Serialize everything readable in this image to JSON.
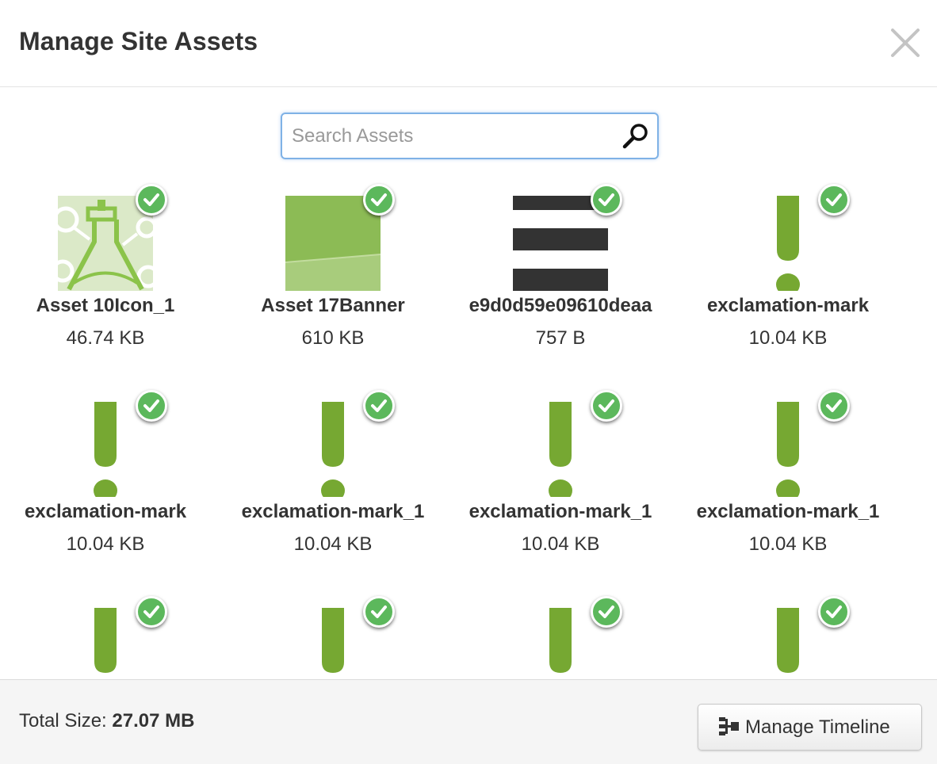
{
  "header": {
    "title": "Manage Site Assets",
    "close_icon": "close-icon"
  },
  "search": {
    "placeholder": "Search Assets",
    "value": "",
    "icon": "search-icon"
  },
  "assets": [
    {
      "name": "Asset 10Icon_1",
      "size": "46.74 KB",
      "thumb": "flask",
      "selected": true
    },
    {
      "name": "Asset 17Banner",
      "size": "610 KB",
      "thumb": "banner",
      "selected": true
    },
    {
      "name": "e9d0d59e09610deaa",
      "size": "757 B",
      "thumb": "hamburger",
      "selected": true
    },
    {
      "name": "exclamation-mark",
      "size": "10.04 KB",
      "thumb": "exclamation",
      "selected": true
    },
    {
      "name": "exclamation-mark",
      "size": "10.04 KB",
      "thumb": "exclamation",
      "selected": true
    },
    {
      "name": "exclamation-mark_1",
      "size": "10.04 KB",
      "thumb": "exclamation",
      "selected": true
    },
    {
      "name": "exclamation-mark_1",
      "size": "10.04 KB",
      "thumb": "exclamation",
      "selected": true
    },
    {
      "name": "exclamation-mark_1",
      "size": "10.04 KB",
      "thumb": "exclamation",
      "selected": true
    },
    {
      "name": "",
      "size": "",
      "thumb": "exclamation",
      "selected": true
    },
    {
      "name": "",
      "size": "",
      "thumb": "exclamation",
      "selected": true
    },
    {
      "name": "",
      "size": "",
      "thumb": "exclamation",
      "selected": true
    },
    {
      "name": "",
      "size": "",
      "thumb": "exclamation",
      "selected": true
    }
  ],
  "footer": {
    "total_label": "Total Size:",
    "total_value": "27.07 MB",
    "button_label": "Manage Timeline",
    "button_icon": "timeline-icon"
  },
  "colors": {
    "accent_green": "#5cb85c",
    "thumb_green": "#76a832",
    "search_border": "#7fb2e6"
  }
}
